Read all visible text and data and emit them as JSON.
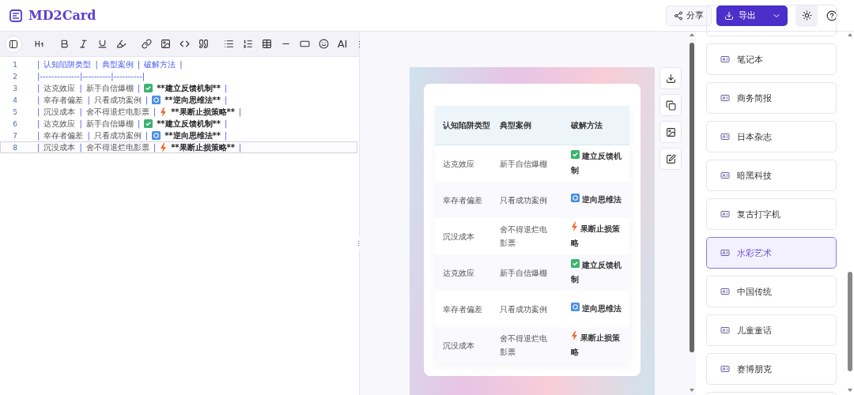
{
  "app": {
    "title": "MD2Card"
  },
  "header_actions": {
    "share": "分享",
    "export": "导出"
  },
  "editor": {
    "toolbar": {
      "ai_label": "AI"
    },
    "lines": [
      {
        "number": "1",
        "current": false,
        "tokens": [
          {
            "kind": "pipe",
            "text": "|"
          },
          {
            "kind": "head",
            "text": "认知陷阱类型"
          },
          {
            "kind": "pipe",
            "text": "|"
          },
          {
            "kind": "head",
            "text": "典型案例"
          },
          {
            "kind": "pipe",
            "text": "|"
          },
          {
            "kind": "head",
            "text": "破解方法"
          },
          {
            "kind": "pipe",
            "text": "|"
          }
        ]
      },
      {
        "number": "2",
        "current": false,
        "tokens": [
          {
            "kind": "pipe",
            "text": "|--------------|----------|----------|"
          }
        ]
      },
      {
        "number": "3",
        "current": false,
        "tokens": [
          {
            "kind": "pipe",
            "text": "|"
          },
          {
            "kind": "cell",
            "text": "达克效应"
          },
          {
            "kind": "pipe",
            "text": "|"
          },
          {
            "kind": "cell",
            "text": "新手自信爆棚"
          },
          {
            "kind": "pipe",
            "text": "|"
          },
          {
            "kind": "check"
          },
          {
            "kind": "strong",
            "text": "**建立反馈机制**"
          },
          {
            "kind": "pipe",
            "text": "|"
          }
        ]
      },
      {
        "number": "4",
        "current": false,
        "tokens": [
          {
            "kind": "pipe",
            "text": "|"
          },
          {
            "kind": "cell",
            "text": "幸存者偏差"
          },
          {
            "kind": "pipe",
            "text": "|"
          },
          {
            "kind": "cell",
            "text": "只看成功案例"
          },
          {
            "kind": "pipe",
            "text": "|"
          },
          {
            "kind": "cycle"
          },
          {
            "kind": "strong",
            "text": "**逆向思维法**"
          },
          {
            "kind": "pipe",
            "text": "|"
          }
        ]
      },
      {
        "number": "5",
        "current": false,
        "tokens": [
          {
            "kind": "pipe",
            "text": "|"
          },
          {
            "kind": "cell",
            "text": "沉没成本"
          },
          {
            "kind": "pipe",
            "text": "|"
          },
          {
            "kind": "cell",
            "text": "舍不得退烂电影票"
          },
          {
            "kind": "pipe",
            "text": "|"
          },
          {
            "kind": "bolt"
          },
          {
            "kind": "strong",
            "text": "**果断止损策略**"
          },
          {
            "kind": "pipe",
            "text": "|"
          }
        ]
      },
      {
        "number": "6",
        "current": false,
        "tokens": [
          {
            "kind": "pipe",
            "text": "|"
          },
          {
            "kind": "cell",
            "text": "达克效应"
          },
          {
            "kind": "pipe",
            "text": "|"
          },
          {
            "kind": "cell",
            "text": "新手自信爆棚"
          },
          {
            "kind": "pipe",
            "text": "|"
          },
          {
            "kind": "check"
          },
          {
            "kind": "strong",
            "text": "**建立反馈机制**"
          },
          {
            "kind": "pipe",
            "text": "|"
          }
        ]
      },
      {
        "number": "7",
        "current": false,
        "tokens": [
          {
            "kind": "pipe",
            "text": "|"
          },
          {
            "kind": "cell",
            "text": "幸存者偏差"
          },
          {
            "kind": "pipe",
            "text": "|"
          },
          {
            "kind": "cell",
            "text": "只看成功案例"
          },
          {
            "kind": "pipe",
            "text": "|"
          },
          {
            "kind": "cycle"
          },
          {
            "kind": "strong",
            "text": "**逆向思维法**"
          },
          {
            "kind": "pipe",
            "text": "|"
          }
        ]
      },
      {
        "number": "8",
        "current": true,
        "tokens": [
          {
            "kind": "pipe",
            "text": "|"
          },
          {
            "kind": "cell",
            "text": "沉没成本"
          },
          {
            "kind": "pipe",
            "text": "|"
          },
          {
            "kind": "cell",
            "text": "舍不得退烂电影票"
          },
          {
            "kind": "pipe",
            "text": "|"
          },
          {
            "kind": "bolt"
          },
          {
            "kind": "strong",
            "text": "**果断止损策略**"
          },
          {
            "kind": "pipe",
            "text": "|"
          }
        ]
      }
    ]
  },
  "preview": {
    "table": {
      "columns": [
        "认知陷阱类型",
        "典型案例",
        "破解方法"
      ],
      "rows": [
        {
          "trap": "达克效应",
          "example": "新手自信爆棚",
          "method": "建立反馈机制",
          "kind": "check"
        },
        {
          "trap": "幸存者偏差",
          "example": "只看成功案例",
          "method": "逆向思维法",
          "kind": "cycle"
        },
        {
          "trap": "沉没成本",
          "example": "舍不得退烂电影票",
          "method": "果断止损策略",
          "kind": "bolt"
        },
        {
          "trap": "达克效应",
          "example": "新手自信爆棚",
          "method": "建立反馈机制",
          "kind": "check"
        },
        {
          "trap": "幸存者偏差",
          "example": "只看成功案例",
          "method": "逆向思维法",
          "kind": "cycle"
        },
        {
          "trap": "沉没成本",
          "example": "舍不得退烂电影票",
          "method": "果断止损策略",
          "kind": "bolt"
        }
      ]
    }
  },
  "templates": [
    {
      "label": "笔记本",
      "selected": false
    },
    {
      "label": "商务简报",
      "selected": false
    },
    {
      "label": "日本杂志",
      "selected": false
    },
    {
      "label": "暗黑科技",
      "selected": false
    },
    {
      "label": "复古打字机",
      "selected": false
    },
    {
      "label": "水彩艺术",
      "selected": true
    },
    {
      "label": "中国传统",
      "selected": false
    },
    {
      "label": "儿童童话",
      "selected": false
    },
    {
      "label": "赛博朋克",
      "selected": false
    }
  ]
}
